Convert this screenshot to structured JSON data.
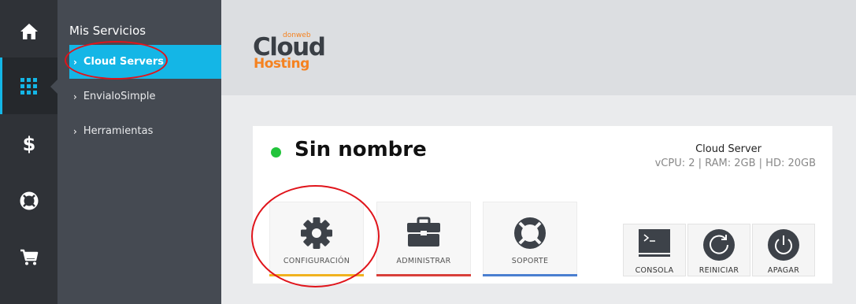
{
  "colors": {
    "accent": "#14b6e6",
    "rail_bg": "#2f3237",
    "panel_bg": "#454a52",
    "status_online": "#22c43b",
    "config_bar": "#f0b21e",
    "admin_bar": "#d9403a",
    "support_bar": "#4a7fd0",
    "annotation": "#e0141b"
  },
  "rail": {
    "items": [
      {
        "icon": "home-icon"
      },
      {
        "icon": "grid-icon",
        "active": true
      },
      {
        "icon": "dollar-icon"
      },
      {
        "icon": "lifebuoy-icon"
      },
      {
        "icon": "cart-icon"
      }
    ]
  },
  "panel": {
    "title": "Mis Servicios",
    "items": [
      {
        "label": "Cloud Servers",
        "active": true
      },
      {
        "label": "EnvialoSimple"
      },
      {
        "label": "Herramientas"
      }
    ]
  },
  "logo": {
    "small": "donweb",
    "cloud": "Cloud",
    "hosting": "Hosting"
  },
  "server": {
    "name": "Sin nombre",
    "status": "online",
    "type": "Cloud Server",
    "specs": "vCPU: 2 | RAM: 2GB | HD: 20GB"
  },
  "actions": [
    {
      "label": "CONFIGURACIÓN",
      "icon": "gear-icon"
    },
    {
      "label": "ADMINISTRAR",
      "icon": "briefcase-icon"
    },
    {
      "label": "SOPORTE",
      "icon": "lifebuoy-icon"
    }
  ],
  "power": [
    {
      "label": "CONSOLA",
      "icon": "terminal-icon"
    },
    {
      "label": "REINICIAR",
      "icon": "restart-icon"
    },
    {
      "label": "APAGAR",
      "icon": "power-icon"
    }
  ]
}
